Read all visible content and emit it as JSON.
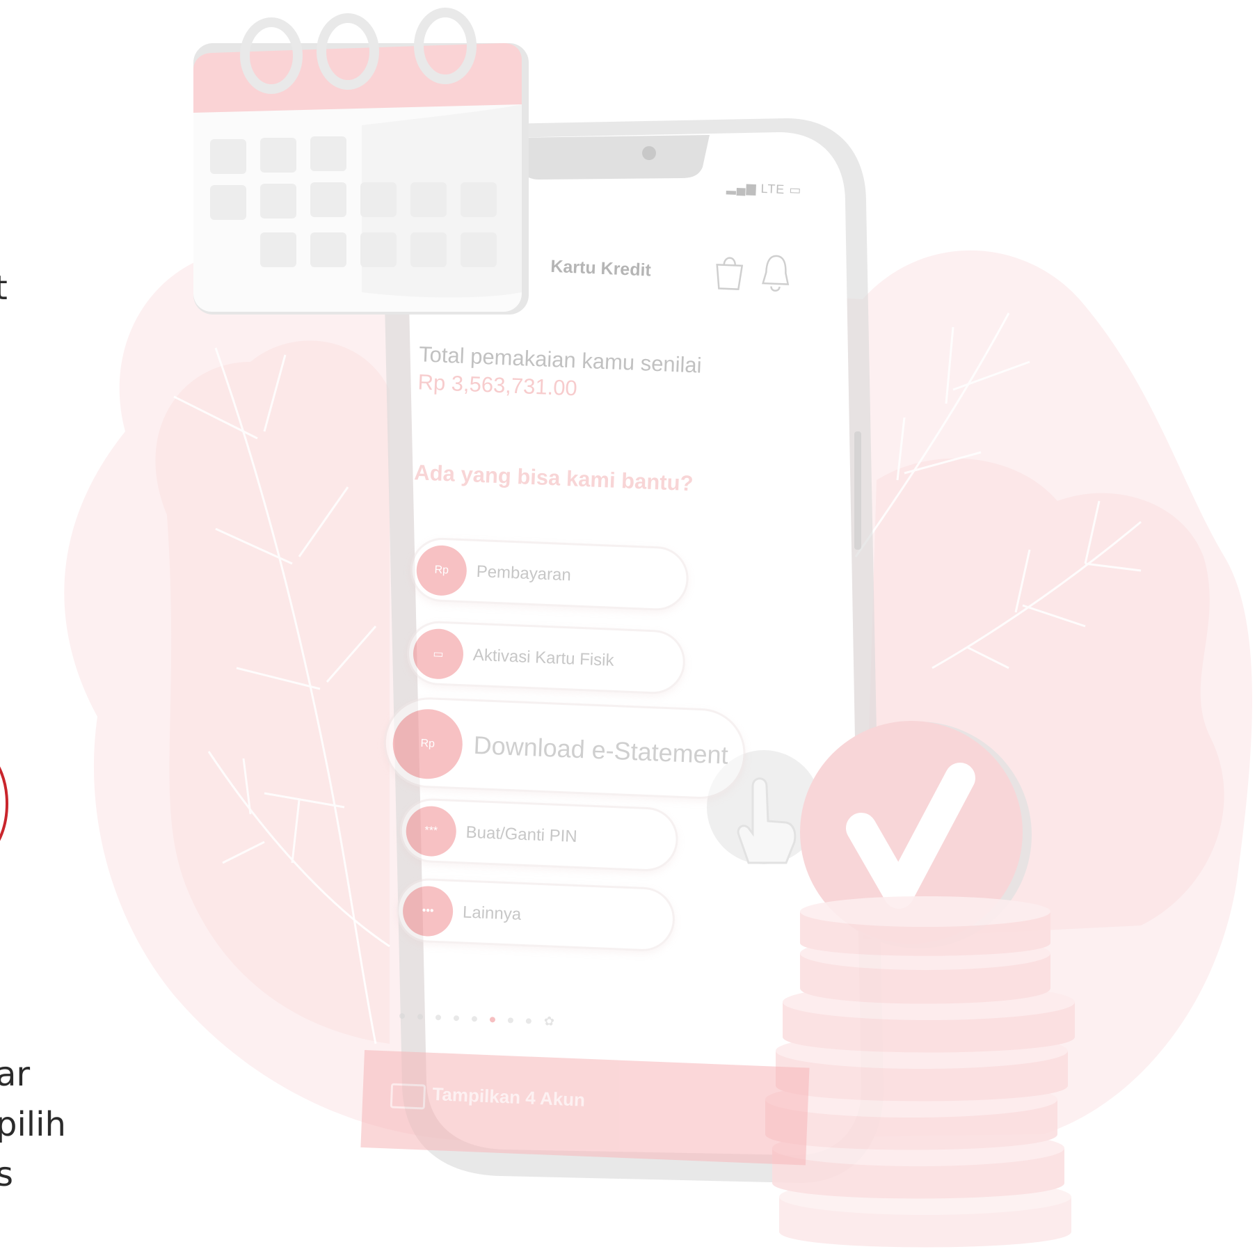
{
  "side_text": {
    "top": "t",
    "bottom_lines": [
      "ar",
      "pilih",
      "s"
    ]
  },
  "phone": {
    "status": "LTE",
    "title": "Kartu Kredit",
    "header_icons": [
      "shopping-bag-icon",
      "bell-icon"
    ],
    "total_label": "Total pemakaian kamu senilai",
    "total_value": "Rp 3,563,731.00",
    "help_title": "Ada yang bisa kami bantu?",
    "menu": [
      {
        "label": "Pembayaran",
        "icon": "receipt-icon",
        "icon_text": "Rp"
      },
      {
        "label": "Aktivasi Kartu Fisik",
        "icon": "card-activation-icon",
        "icon_text": "▭"
      },
      {
        "label": "Download e-Statement",
        "icon": "document-rp-icon",
        "icon_text": "Rp"
      },
      {
        "label": "Buat/Ganti PIN",
        "icon": "pin-icon",
        "icon_text": "***"
      },
      {
        "label": "Lainnya",
        "icon": "more-icon",
        "icon_text": "•••"
      }
    ],
    "accounts_button": "Tampilkan 4 Akun"
  },
  "colors": {
    "accent": "#f28f93",
    "blob": "#fdecec",
    "check": "#f7cdcf",
    "muted_text": "#8f8f8f"
  }
}
